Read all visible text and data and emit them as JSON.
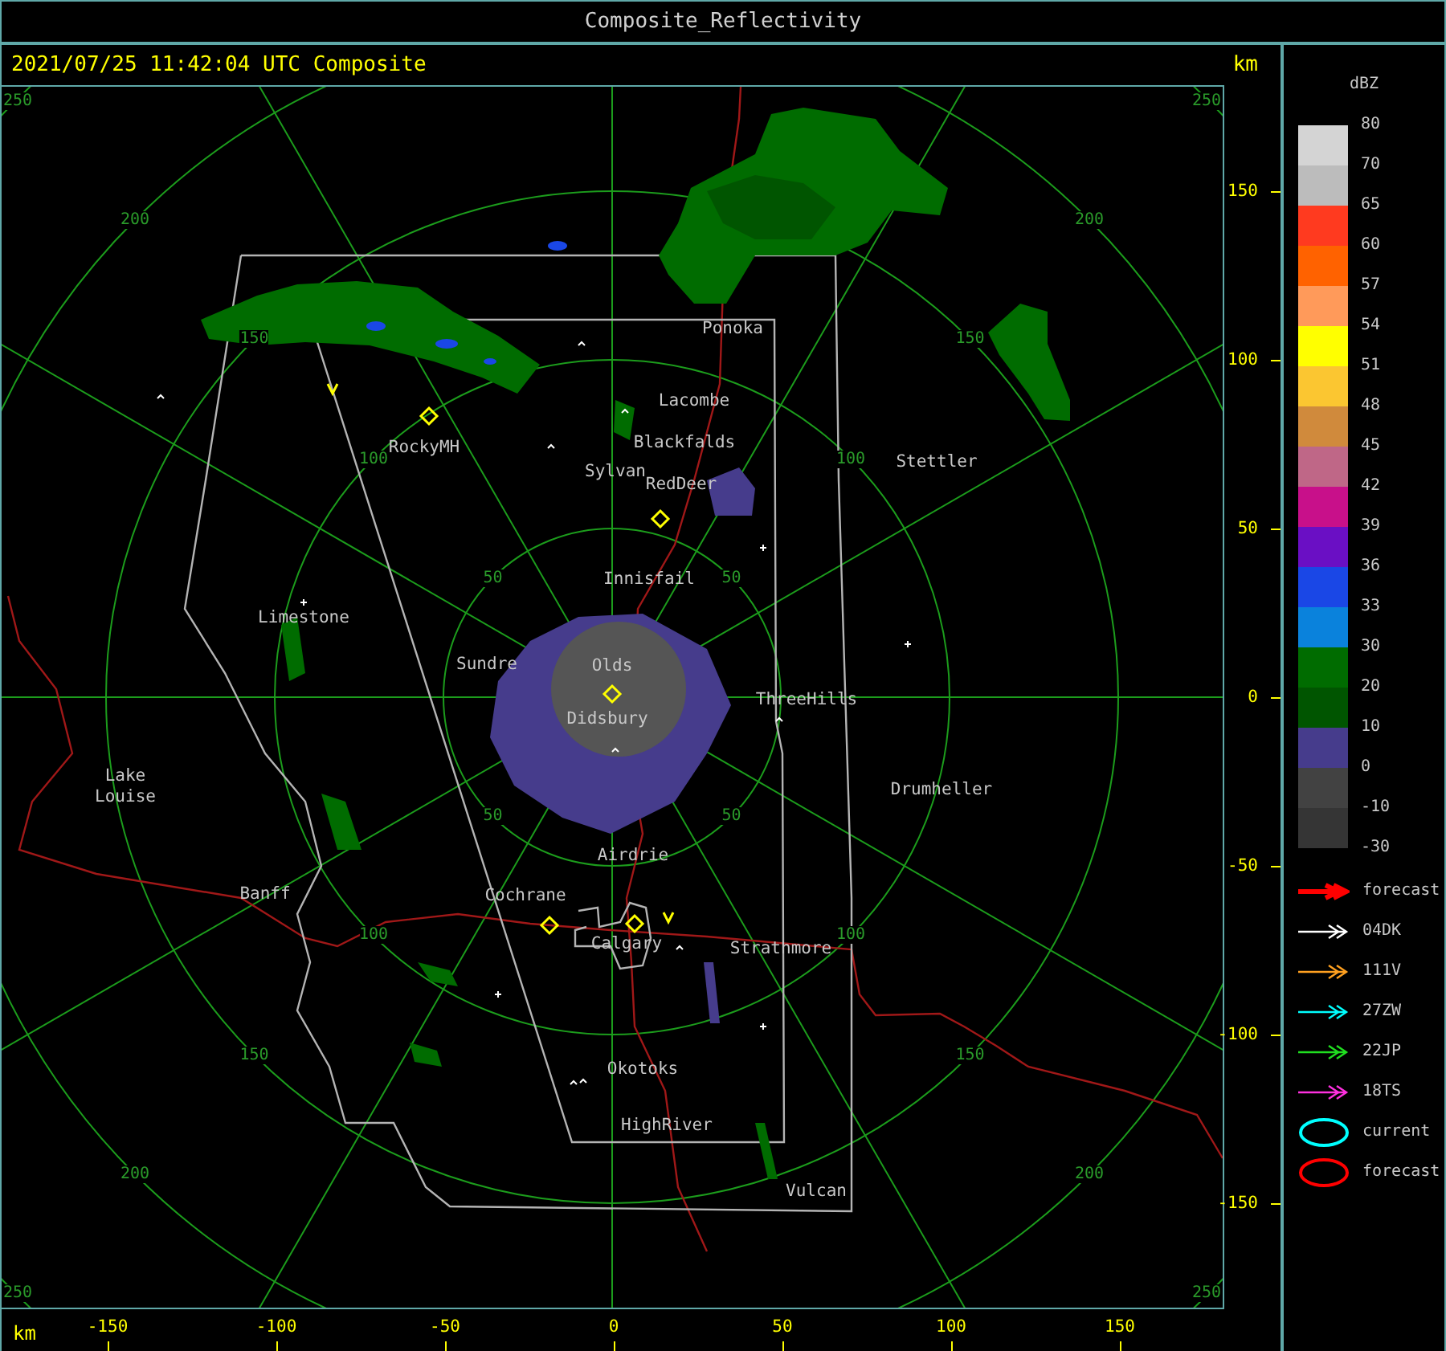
{
  "window": {
    "title": "Composite_Reflectivity"
  },
  "header": {
    "timestamp": "2021/07/25 11:42:04 UTC Composite",
    "y_unit": "km"
  },
  "map": {
    "range_rings": [
      {
        "labels": [
          "50",
          "50",
          "50",
          "50"
        ]
      },
      {
        "labels": [
          "100",
          "100",
          "100",
          "100"
        ]
      },
      {
        "labels": [
          "150",
          "150",
          "150",
          "150"
        ]
      },
      {
        "labels": [
          "200",
          "200",
          "200",
          "200"
        ]
      },
      {
        "labels": [
          "250",
          "250",
          "250",
          "250"
        ]
      }
    ],
    "cities": [
      {
        "name": "Ponoka"
      },
      {
        "name": "Lacombe"
      },
      {
        "name": "Blackfalds"
      },
      {
        "name": "Sylvan"
      },
      {
        "name": "RedDeer"
      },
      {
        "name": "Stettler"
      },
      {
        "name": "RockyMH"
      },
      {
        "name": "Innisfail"
      },
      {
        "name": "Limestone"
      },
      {
        "name": "Sundre"
      },
      {
        "name": "Olds"
      },
      {
        "name": "ThreeHills"
      },
      {
        "name": "Didsbury"
      },
      {
        "name": "Drumheller"
      },
      {
        "name": "Lake\nLouise"
      },
      {
        "name": "Airdrie"
      },
      {
        "name": "Banff"
      },
      {
        "name": "Cochrane"
      },
      {
        "name": "Calgary"
      },
      {
        "name": "Strathmore"
      },
      {
        "name": "Okotoks"
      },
      {
        "name": "HighRiver"
      },
      {
        "name": "Vulcan"
      }
    ]
  },
  "y_axis": {
    "ticks": [
      "150",
      "100",
      "50",
      "0",
      "-50",
      "-100",
      "-150"
    ]
  },
  "x_axis": {
    "unit": "km",
    "ticks": [
      "-150",
      "-100",
      "-50",
      "0",
      "50",
      "100",
      "150"
    ]
  },
  "legend": {
    "unit": "dBZ",
    "bands": [
      {
        "label": "80",
        "color": "#d4d4d4"
      },
      {
        "label": "70",
        "color": "#bcbcbc"
      },
      {
        "label": "65",
        "color": "#ff3a1f"
      },
      {
        "label": "60",
        "color": "#ff6200"
      },
      {
        "label": "57",
        "color": "#ff9a5a"
      },
      {
        "label": "54",
        "color": "#ffff00"
      },
      {
        "label": "51",
        "color": "#fbc631"
      },
      {
        "label": "48",
        "color": "#d08a3c"
      },
      {
        "label": "45",
        "color": "#bf6787"
      },
      {
        "label": "42",
        "color": "#c8108a"
      },
      {
        "label": "39",
        "color": "#6a0fc4"
      },
      {
        "label": "36",
        "color": "#1a47e6"
      },
      {
        "label": "33",
        "color": "#0a82dc"
      },
      {
        "label": "30",
        "color": "#006c00"
      },
      {
        "label": "20",
        "color": "#005500"
      },
      {
        "label": "10",
        "color": "#463c8c"
      },
      {
        "label": "0",
        "color": "#424242"
      },
      {
        "label": "-10",
        "color": "#353535"
      }
    ],
    "bottom_label": "-30",
    "tracks": [
      {
        "kind": "forecast_arrow",
        "label": "forecast",
        "color": "#ff0000"
      },
      {
        "kind": "arrow",
        "label": "04DK",
        "color": "#ffffff"
      },
      {
        "kind": "arrow",
        "label": "111V",
        "color": "#ffa020"
      },
      {
        "kind": "arrow",
        "label": "27ZW",
        "color": "#00ffff"
      },
      {
        "kind": "arrow",
        "label": "22JP",
        "color": "#20e020"
      },
      {
        "kind": "arrow",
        "label": "18TS",
        "color": "#ff30e0"
      },
      {
        "kind": "ellipse",
        "label": "current",
        "color": "#00ffff"
      },
      {
        "kind": "ellipse",
        "label": "forecast",
        "color": "#ff0000"
      }
    ]
  }
}
